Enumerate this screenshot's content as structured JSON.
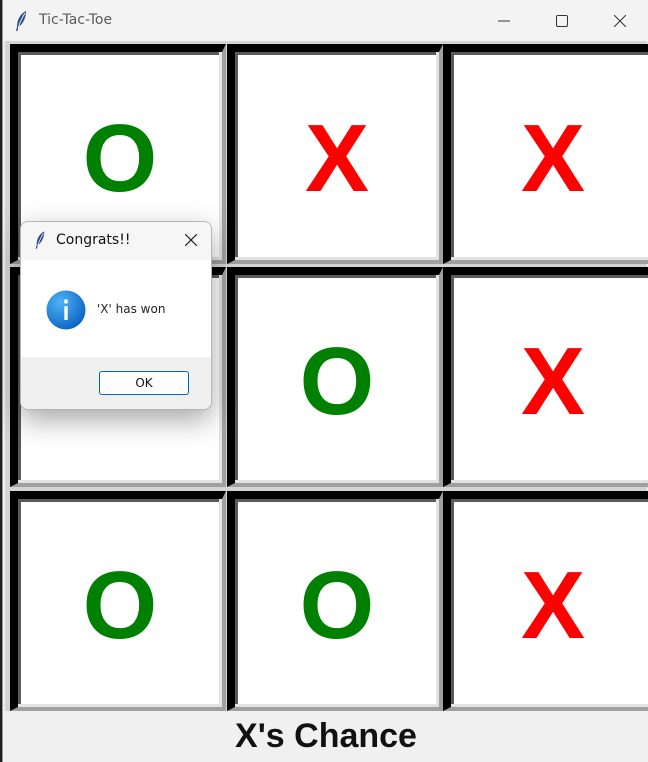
{
  "window": {
    "title": "Tic-Tac-Toe",
    "icon": "feather-icon",
    "controls": [
      "minimize-icon",
      "maximize-icon",
      "close-icon"
    ]
  },
  "board": {
    "cells": [
      {
        "mark": "O",
        "color": "#008000"
      },
      {
        "mark": "X",
        "color": "#ff0000"
      },
      {
        "mark": "X",
        "color": "#ff0000"
      },
      {
        "mark": "",
        "color": "#008000"
      },
      {
        "mark": "O",
        "color": "#008000"
      },
      {
        "mark": "X",
        "color": "#ff0000"
      },
      {
        "mark": "O",
        "color": "#008000"
      },
      {
        "mark": "O",
        "color": "#008000"
      },
      {
        "mark": "X",
        "color": "#ff0000"
      }
    ]
  },
  "status": {
    "text": "X's Chance"
  },
  "dialog": {
    "title": "Congrats!!",
    "icon": "info-icon",
    "message": "'X' has won",
    "ok_label": "OK",
    "accent": "#0067c0"
  }
}
